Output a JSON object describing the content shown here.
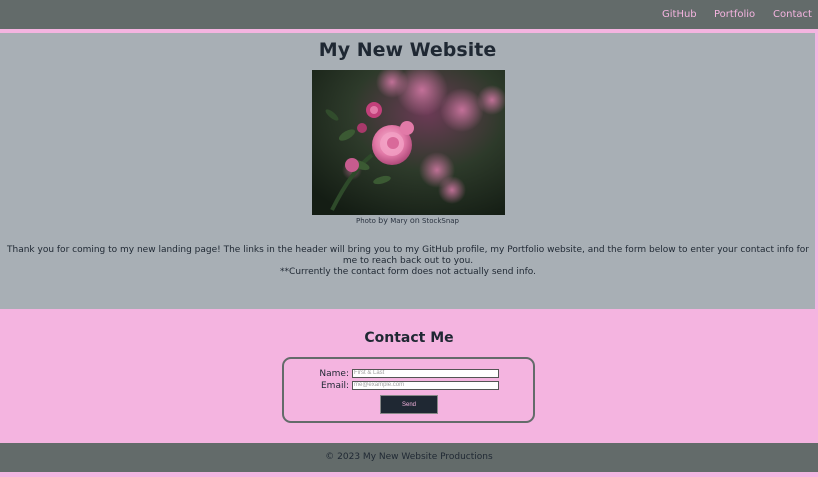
{
  "header": {
    "nav": [
      {
        "label": "GitHub"
      },
      {
        "label": "Portfolio"
      },
      {
        "label": "Contact"
      }
    ]
  },
  "main": {
    "title": "My New Website",
    "photo_credit": {
      "prefix": "Photo",
      "by": "by",
      "author": "Mary",
      "on": "on",
      "source": "StockSnap"
    },
    "intro_line1": "Thank you for coming to my new landing page! The links in the header will bring you to my GitHub profile, my Portfolio website, and the form below to enter your contact info for me to reach back out to you.",
    "intro_line2": "**Currently the contact form does not actually send info."
  },
  "contact": {
    "title": "Contact Me",
    "name_label": "Name:",
    "name_placeholder": "First & Last",
    "email_label": "Email:",
    "email_placeholder": "me@example.com",
    "send_label": "Send"
  },
  "footer": {
    "text": "© 2023 My New Website Productions"
  },
  "colors": {
    "header_bg": "#636b6a",
    "accent_pink": "#f4b4e0",
    "main_bg": "#a8afb5",
    "dark_text": "#1f2833"
  },
  "icons": {
    "hero_image": "pink-rose-photo"
  }
}
